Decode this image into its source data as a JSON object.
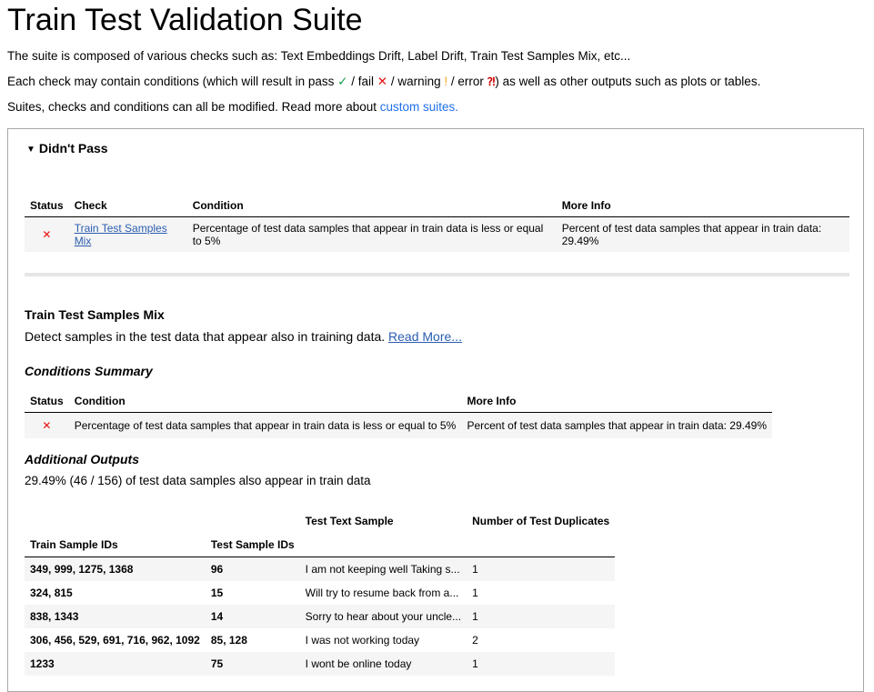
{
  "title": "Train Test Validation Suite",
  "intro": {
    "line1": "The suite is composed of various checks such as: Text Embeddings Drift, Label Drift, Train Test Samples Mix, etc...",
    "line2_a": "Each check may contain conditions (which will result in pass ",
    "pass_symbol": "✓",
    "line2_b": " / fail ",
    "fail_symbol": "✕",
    "line2_c": " / warning ",
    "warning_symbol": "!",
    "line2_d": " / error ",
    "error_symbol": "⁈",
    "line2_e": ") as well as other outputs such as plots or tables.",
    "line3_a": "Suites, checks and conditions can all be modified. Read more about ",
    "line3_link": "custom suites.",
    "line3_b": ""
  },
  "didnt_pass": {
    "summary": "Didn't Pass",
    "headers": [
      "Status",
      "Check",
      "Condition",
      "More Info"
    ],
    "rows": [
      {
        "status_icon": "✕",
        "check": "Train Test Samples Mix",
        "condition": "Percentage of test data samples that appear in train data is less or equal to 5%",
        "more_info": "Percent of test data samples that appear in train data: 29.49%"
      }
    ]
  },
  "check": {
    "title": "Train Test Samples Mix",
    "description": "Detect samples in the test data that appear also in training data. ",
    "read_more": "Read More..."
  },
  "conditions_summary": {
    "heading": "Conditions Summary",
    "headers": [
      "Status",
      "Condition",
      "More Info"
    ],
    "rows": [
      {
        "status_icon": "✕",
        "condition": "Percentage of test data samples that appear in train data is less or equal to 5%",
        "more_info": "Percent of test data samples that appear in train data: 29.49%"
      }
    ]
  },
  "additional_outputs": {
    "heading": "Additional Outputs",
    "text": "29.49% (46 / 156) of test data samples also appear in train data",
    "table": {
      "header_top": [
        "",
        "",
        "Test Text Sample",
        "Number of Test Duplicates"
      ],
      "header_index": [
        "Train Sample IDs",
        "Test Sample IDs",
        "",
        ""
      ],
      "rows": [
        [
          "349, 999, 1275, 1368",
          "96",
          "I am not keeping well Taking s...",
          "1"
        ],
        [
          "324, 815",
          "15",
          "Will try to resume back from a...",
          "1"
        ],
        [
          "838, 1343",
          "14",
          "Sorry to hear about your uncle...",
          "1"
        ],
        [
          "306, 456, 529, 691, 716, 962, 1092",
          "85, 128",
          "I  was not working today",
          "2"
        ],
        [
          "1233",
          "75",
          "I wont be online today",
          "1"
        ]
      ]
    }
  },
  "colors": {
    "pass": "#16a34a",
    "fail": "#e81111",
    "warning": "#f5a623",
    "error": "#d00000",
    "link": "#2a5db0"
  }
}
